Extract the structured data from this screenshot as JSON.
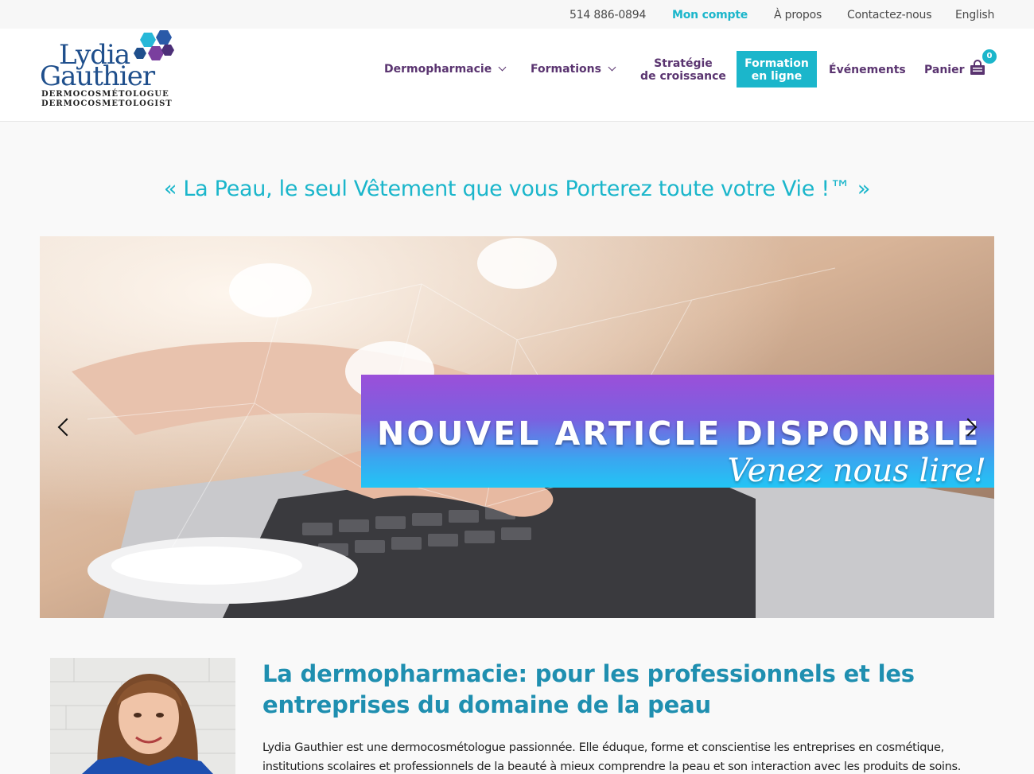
{
  "topbar": {
    "phone": "514 886-0894",
    "account": "Mon compte",
    "about": "À propos",
    "contact": "Contactez-nous",
    "language": "English"
  },
  "logo": {
    "line1": "Lydia",
    "line2": "Gauthier",
    "sub1": "DERMOCOSMÉTOLOGUE",
    "sub2": "DERMOCOSMETOLOGIST"
  },
  "nav": {
    "dermopharmacie": "Dermopharmacie",
    "formations": "Formations",
    "strategie_line1": "Stratégie",
    "strategie_line2": "de croissance",
    "online_line1": "Formation",
    "online_line2": "en ligne",
    "evenements": "Événements",
    "panier": "Panier",
    "cart_count": "0"
  },
  "tagline": "« La Peau, le seul Vêtement que vous Porterez toute votre Vie !™ »",
  "slider": {
    "banner_title": "NOUVEL ARTICLE DISPONIBLE",
    "banner_subtitle": "Venez nous lire!"
  },
  "intro": {
    "title": "La dermopharmacie: pour les professionnels et les entreprises du domaine de la peau",
    "text": "Lydia Gauthier est une dermocosmétologue passionnée. Elle éduque, forme et conscientise les entreprises en cosmétique, institutions scolaires et professionnels de la beauté à mieux comprendre la peau et son interaction avec les produits de soins. Afin"
  },
  "colors": {
    "accent": "#1bb6cb",
    "nav_purple": "#5a3470",
    "title_blue": "#1f8fb0",
    "logo_blue": "#1f4f8c"
  }
}
